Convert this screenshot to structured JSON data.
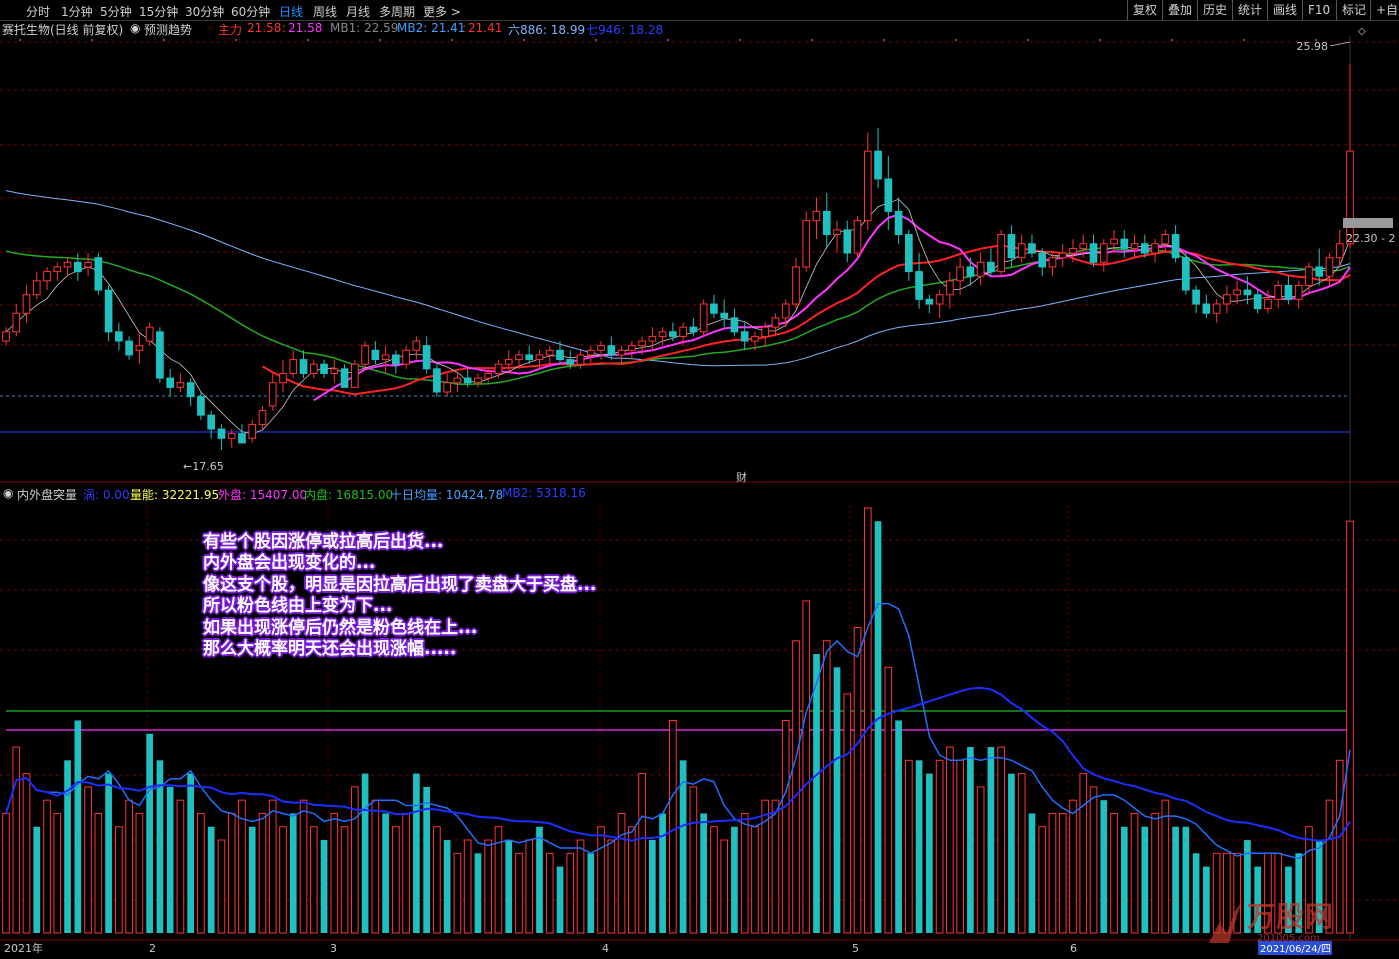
{
  "toolbar": {
    "periods": [
      "分时",
      "1分钟",
      "5分钟",
      "15分钟",
      "30分钟",
      "60分钟",
      "日线",
      "周线",
      "月线",
      "多周期",
      "更多 >"
    ],
    "active_period": "日线",
    "right_buttons": [
      "复权",
      "叠加",
      "历史",
      "统计",
      "画线",
      "F10",
      "标记",
      "+自选"
    ]
  },
  "main_info": {
    "stock_title": "赛托生物(日线 前复权)",
    "forecast_label": "预测趋势",
    "zhuli_label": "主力",
    "zhuli_value1": "21.58",
    "zhuli_value2": "21.58",
    "mb1_label": "MB1: 22.59",
    "mb2_label": "MB2: 21.41",
    "mb2_value2": "21.41",
    "liu_label": "六886: 18.99",
    "qi_label": "七946: 18.28"
  },
  "sub_info": {
    "indicator_name": "内外盘突量",
    "hint_label": "涡: 0.00",
    "liang_label": "量能: 32221.95",
    "wai_label": "外盘: 15407.00",
    "nei_label": "内盘: 16815.00",
    "avg_label": "十日均量: 10424.78",
    "mb2_label": "MB2: 5318.16"
  },
  "price_labels": {
    "high": "25.98",
    "low": "17.65",
    "last": "22.30 - 2"
  },
  "cai_label": "财",
  "date_axis": {
    "year_label": "2021年",
    "months": [
      "2",
      "3",
      "4",
      "5",
      "6"
    ],
    "current_date": "2021/06/24/四"
  },
  "overlay_text": [
    "有些个股因涨停或拉高后出货...",
    "内外盘会出现变化的...",
    "像这支个股，明显是因拉高后出现了卖盘大于买盘...",
    "所以粉色线由上变为下...",
    "如果出现涨停后仍然是粉色线在上...",
    "那么大概率明天还会出现涨幅....."
  ],
  "watermark": {
    "text": "万股网",
    "sub": "201005.com"
  },
  "colors": {
    "up": "#ff3333",
    "down": "#20c0c0",
    "ma_white": "#7fb2ff",
    "ma_green": "#22aa22",
    "ma_pink": "#ff33ff",
    "ma_red": "#ff2222",
    "vol_avg": "#1e6fff",
    "vol_avg2": "#1a2fff"
  },
  "chart_data": {
    "type": "candlestick",
    "price_ylim": [
      17.0,
      26.5
    ],
    "volume_ylim": [
      0,
      32221.95
    ],
    "candles": [
      [
        20.0,
        20.3,
        19.9,
        20.2
      ],
      [
        20.2,
        20.8,
        20.1,
        20.6
      ],
      [
        20.6,
        21.2,
        20.4,
        21.0
      ],
      [
        21.0,
        21.5,
        20.9,
        21.3
      ],
      [
        21.3,
        21.6,
        21.1,
        21.5
      ],
      [
        21.5,
        21.7,
        21.3,
        21.6
      ],
      [
        21.6,
        21.8,
        21.4,
        21.7
      ],
      [
        21.7,
        21.9,
        21.3,
        21.5
      ],
      [
        21.6,
        21.9,
        21.4,
        21.7
      ],
      [
        21.8,
        21.9,
        21.0,
        21.1
      ],
      [
        21.1,
        21.2,
        20.0,
        20.2
      ],
      [
        20.2,
        20.4,
        19.8,
        20.0
      ],
      [
        20.0,
        20.1,
        19.6,
        19.7
      ],
      [
        19.8,
        20.2,
        19.5,
        19.9
      ],
      [
        20.0,
        20.4,
        19.9,
        20.3
      ],
      [
        20.2,
        20.3,
        19.1,
        19.2
      ],
      [
        19.2,
        19.4,
        18.8,
        19.0
      ],
      [
        19.0,
        19.3,
        18.9,
        19.1
      ],
      [
        19.1,
        19.2,
        18.6,
        18.8
      ],
      [
        18.8,
        18.9,
        18.3,
        18.4
      ],
      [
        18.4,
        18.5,
        17.9,
        18.1
      ],
      [
        18.1,
        18.2,
        17.65,
        17.9
      ],
      [
        17.9,
        18.1,
        17.7,
        18.0
      ],
      [
        18.0,
        18.2,
        17.8,
        17.8
      ],
      [
        17.9,
        18.3,
        17.8,
        18.2
      ],
      [
        18.2,
        18.6,
        18.1,
        18.5
      ],
      [
        18.6,
        19.3,
        18.5,
        19.1
      ],
      [
        19.1,
        19.6,
        18.9,
        19.3
      ],
      [
        19.3,
        19.8,
        19.2,
        19.6
      ],
      [
        19.6,
        19.8,
        19.2,
        19.3
      ],
      [
        19.3,
        19.6,
        19.2,
        19.5
      ],
      [
        19.5,
        19.6,
        19.2,
        19.3
      ],
      [
        19.3,
        19.6,
        19.1,
        19.4
      ],
      [
        19.4,
        19.5,
        19.0,
        19.0
      ],
      [
        19.0,
        19.6,
        19.0,
        19.5
      ],
      [
        19.5,
        20.0,
        19.4,
        19.9
      ],
      [
        19.8,
        20.0,
        19.5,
        19.6
      ],
      [
        19.6,
        19.9,
        19.3,
        19.7
      ],
      [
        19.7,
        19.8,
        19.3,
        19.5
      ],
      [
        19.5,
        19.9,
        19.4,
        19.8
      ],
      [
        19.8,
        20.1,
        19.6,
        20.0
      ],
      [
        19.9,
        20.1,
        19.3,
        19.4
      ],
      [
        19.4,
        19.5,
        18.8,
        18.9
      ],
      [
        18.9,
        19.3,
        18.8,
        19.1
      ],
      [
        19.1,
        19.3,
        18.9,
        19.2
      ],
      [
        19.2,
        19.4,
        19.0,
        19.1
      ],
      [
        19.1,
        19.3,
        19.0,
        19.2
      ],
      [
        19.2,
        19.4,
        19.1,
        19.3
      ],
      [
        19.3,
        19.6,
        19.2,
        19.5
      ],
      [
        19.5,
        19.8,
        19.3,
        19.6
      ],
      [
        19.6,
        19.8,
        19.4,
        19.7
      ],
      [
        19.7,
        19.9,
        19.5,
        19.6
      ],
      [
        19.6,
        19.8,
        19.4,
        19.7
      ],
      [
        19.7,
        19.9,
        19.5,
        19.8
      ],
      [
        19.8,
        20.0,
        19.5,
        19.6
      ],
      [
        19.6,
        19.8,
        19.4,
        19.5
      ],
      [
        19.5,
        19.8,
        19.4,
        19.7
      ],
      [
        19.7,
        19.9,
        19.5,
        19.8
      ],
      [
        19.8,
        20.0,
        19.6,
        19.9
      ],
      [
        19.9,
        20.1,
        19.6,
        19.7
      ],
      [
        19.7,
        19.9,
        19.5,
        19.8
      ],
      [
        19.8,
        20.0,
        19.6,
        19.9
      ],
      [
        19.9,
        20.1,
        19.7,
        20.0
      ],
      [
        20.0,
        20.3,
        19.8,
        20.1
      ],
      [
        20.1,
        20.3,
        19.9,
        20.2
      ],
      [
        20.2,
        20.4,
        20.0,
        20.1
      ],
      [
        20.1,
        20.4,
        19.9,
        20.3
      ],
      [
        20.3,
        20.5,
        20.1,
        20.2
      ],
      [
        20.2,
        20.9,
        20.1,
        20.8
      ],
      [
        20.8,
        21.0,
        20.5,
        20.6
      ],
      [
        20.6,
        20.9,
        20.3,
        20.5
      ],
      [
        20.5,
        20.7,
        20.1,
        20.2
      ],
      [
        20.2,
        20.4,
        19.8,
        20.0
      ],
      [
        20.0,
        20.2,
        19.8,
        20.1
      ],
      [
        20.1,
        20.4,
        19.9,
        20.3
      ],
      [
        20.3,
        20.6,
        20.1,
        20.5
      ],
      [
        20.5,
        20.9,
        20.3,
        20.8
      ],
      [
        20.8,
        21.8,
        20.7,
        21.6
      ],
      [
        21.6,
        22.8,
        21.5,
        22.6
      ],
      [
        22.6,
        23.1,
        22.2,
        22.8
      ],
      [
        22.8,
        23.2,
        22.0,
        22.3
      ],
      [
        22.3,
        22.6,
        21.9,
        22.4
      ],
      [
        22.4,
        22.6,
        21.7,
        21.9
      ],
      [
        21.9,
        22.7,
        21.8,
        22.6
      ],
      [
        22.6,
        24.5,
        22.4,
        24.1
      ],
      [
        24.1,
        24.6,
        23.3,
        23.5
      ],
      [
        23.5,
        24.0,
        22.4,
        22.8
      ],
      [
        22.8,
        23.1,
        22.1,
        22.3
      ],
      [
        22.3,
        22.4,
        21.3,
        21.5
      ],
      [
        21.5,
        21.9,
        20.7,
        20.9
      ],
      [
        20.9,
        21.0,
        20.6,
        20.8
      ],
      [
        20.8,
        21.1,
        20.5,
        21.0
      ],
      [
        21.0,
        21.5,
        20.7,
        21.3
      ],
      [
        21.3,
        21.8,
        21.0,
        21.6
      ],
      [
        21.6,
        21.8,
        21.2,
        21.4
      ],
      [
        21.4,
        21.9,
        21.2,
        21.7
      ],
      [
        21.7,
        22.0,
        21.4,
        21.5
      ],
      [
        21.5,
        22.4,
        21.4,
        22.3
      ],
      [
        22.3,
        22.5,
        21.6,
        21.8
      ],
      [
        21.8,
        22.3,
        21.7,
        22.1
      ],
      [
        22.1,
        22.3,
        21.8,
        21.9
      ],
      [
        21.9,
        22.0,
        21.4,
        21.6
      ],
      [
        21.6,
        21.9,
        21.4,
        21.8
      ],
      [
        21.8,
        22.1,
        21.6,
        21.9
      ],
      [
        21.9,
        22.2,
        21.7,
        22.0
      ],
      [
        22.0,
        22.3,
        21.8,
        22.1
      ],
      [
        22.1,
        22.3,
        21.6,
        21.7
      ],
      [
        21.7,
        22.2,
        21.5,
        22.1
      ],
      [
        22.1,
        22.4,
        21.9,
        22.2
      ],
      [
        22.2,
        22.4,
        21.8,
        22.0
      ],
      [
        22.0,
        22.3,
        21.8,
        22.1
      ],
      [
        22.1,
        22.3,
        21.8,
        21.9
      ],
      [
        21.9,
        22.2,
        21.7,
        22.1
      ],
      [
        22.1,
        22.4,
        21.9,
        22.3
      ],
      [
        22.3,
        22.5,
        21.7,
        21.8
      ],
      [
        21.8,
        21.9,
        21.0,
        21.1
      ],
      [
        21.1,
        21.2,
        20.6,
        20.8
      ],
      [
        20.8,
        21.0,
        20.5,
        20.6
      ],
      [
        20.6,
        20.9,
        20.4,
        20.8
      ],
      [
        20.8,
        21.2,
        20.6,
        21.0
      ],
      [
        21.0,
        21.3,
        20.8,
        21.1
      ],
      [
        21.1,
        21.4,
        20.8,
        21.0
      ],
      [
        21.0,
        21.1,
        20.6,
        20.7
      ],
      [
        20.7,
        21.1,
        20.6,
        20.9
      ],
      [
        20.9,
        21.3,
        20.7,
        21.2
      ],
      [
        21.2,
        21.4,
        20.8,
        20.9
      ],
      [
        20.9,
        21.3,
        20.7,
        21.2
      ],
      [
        21.2,
        21.7,
        21.0,
        21.6
      ],
      [
        21.6,
        22.0,
        21.2,
        21.4
      ],
      [
        21.4,
        21.9,
        21.2,
        21.8
      ],
      [
        21.8,
        22.4,
        21.6,
        22.1
      ],
      [
        22.1,
        25.98,
        22.0,
        24.1
      ]
    ],
    "volumes": [
      [
        9000,
        1
      ],
      [
        14000,
        1
      ],
      [
        12000,
        1
      ],
      [
        8000,
        0
      ],
      [
        10000,
        1
      ],
      [
        9000,
        1
      ],
      [
        13000,
        0
      ],
      [
        16000,
        0
      ],
      [
        11000,
        1
      ],
      [
        9000,
        1
      ],
      [
        12000,
        0
      ],
      [
        8000,
        1
      ],
      [
        10000,
        1
      ],
      [
        9000,
        1
      ],
      [
        15000,
        0
      ],
      [
        13000,
        0
      ],
      [
        11000,
        0
      ],
      [
        10000,
        1
      ],
      [
        12000,
        0
      ],
      [
        9000,
        1
      ],
      [
        8000,
        0
      ],
      [
        7000,
        1
      ],
      [
        9000,
        1
      ],
      [
        10000,
        1
      ],
      [
        8000,
        0
      ],
      [
        9000,
        1
      ],
      [
        10000,
        1
      ],
      [
        8000,
        1
      ],
      [
        9000,
        0
      ],
      [
        10000,
        1
      ],
      [
        8000,
        1
      ],
      [
        7000,
        0
      ],
      [
        9000,
        1
      ],
      [
        8000,
        1
      ],
      [
        11000,
        1
      ],
      [
        12000,
        0
      ],
      [
        10000,
        1
      ],
      [
        9000,
        0
      ],
      [
        8000,
        1
      ],
      [
        9000,
        1
      ],
      [
        12000,
        0
      ],
      [
        11000,
        0
      ],
      [
        8000,
        1
      ],
      [
        7000,
        0
      ],
      [
        6000,
        1
      ],
      [
        7000,
        1
      ],
      [
        6000,
        0
      ],
      [
        7000,
        1
      ],
      [
        8000,
        1
      ],
      [
        7000,
        0
      ],
      [
        6000,
        1
      ],
      [
        7000,
        1
      ],
      [
        8000,
        0
      ],
      [
        6000,
        1
      ],
      [
        5000,
        0
      ],
      [
        6000,
        1
      ],
      [
        7000,
        1
      ],
      [
        6000,
        0
      ],
      [
        8000,
        1
      ],
      [
        7000,
        1
      ],
      [
        9000,
        1
      ],
      [
        8000,
        1
      ],
      [
        12000,
        1
      ],
      [
        7000,
        0
      ],
      [
        9000,
        0
      ],
      [
        16000,
        1
      ],
      [
        13000,
        0
      ],
      [
        11000,
        1
      ],
      [
        9000,
        0
      ],
      [
        8000,
        1
      ],
      [
        7000,
        1
      ],
      [
        8000,
        0
      ],
      [
        9000,
        1
      ],
      [
        8000,
        1
      ],
      [
        10000,
        1
      ],
      [
        10000,
        1
      ],
      [
        16000,
        1
      ],
      [
        22000,
        1
      ],
      [
        25000,
        1
      ],
      [
        21000,
        0
      ],
      [
        22000,
        1
      ],
      [
        20000,
        0
      ],
      [
        18000,
        1
      ],
      [
        23000,
        1
      ],
      [
        32000,
        1
      ],
      [
        31000,
        0
      ],
      [
        20000,
        1
      ],
      [
        16000,
        0
      ],
      [
        13000,
        1
      ],
      [
        13000,
        0
      ],
      [
        12000,
        0
      ],
      [
        13000,
        1
      ],
      [
        14000,
        1
      ],
      [
        13000,
        1
      ],
      [
        14000,
        0
      ],
      [
        11000,
        1
      ],
      [
        14000,
        0
      ],
      [
        14000,
        1
      ],
      [
        12000,
        0
      ],
      [
        12000,
        1
      ],
      [
        9000,
        0
      ],
      [
        8000,
        1
      ],
      [
        9000,
        1
      ],
      [
        9000,
        1
      ],
      [
        10000,
        1
      ],
      [
        12000,
        1
      ],
      [
        11000,
        1
      ],
      [
        10000,
        0
      ],
      [
        9000,
        1
      ],
      [
        8000,
        0
      ],
      [
        9000,
        1
      ],
      [
        8000,
        0
      ],
      [
        9000,
        1
      ],
      [
        10000,
        1
      ],
      [
        8000,
        0
      ],
      [
        8000,
        0
      ],
      [
        6000,
        0
      ],
      [
        5000,
        0
      ],
      [
        6000,
        1
      ],
      [
        6000,
        1
      ],
      [
        6000,
        1
      ],
      [
        7000,
        0
      ],
      [
        5000,
        0
      ],
      [
        6000,
        1
      ],
      [
        6000,
        1
      ],
      [
        5000,
        0
      ],
      [
        6000,
        0
      ],
      [
        8000,
        1
      ],
      [
        7000,
        0
      ],
      [
        10000,
        1
      ],
      [
        13000,
        1
      ],
      [
        31000,
        1
      ]
    ]
  }
}
